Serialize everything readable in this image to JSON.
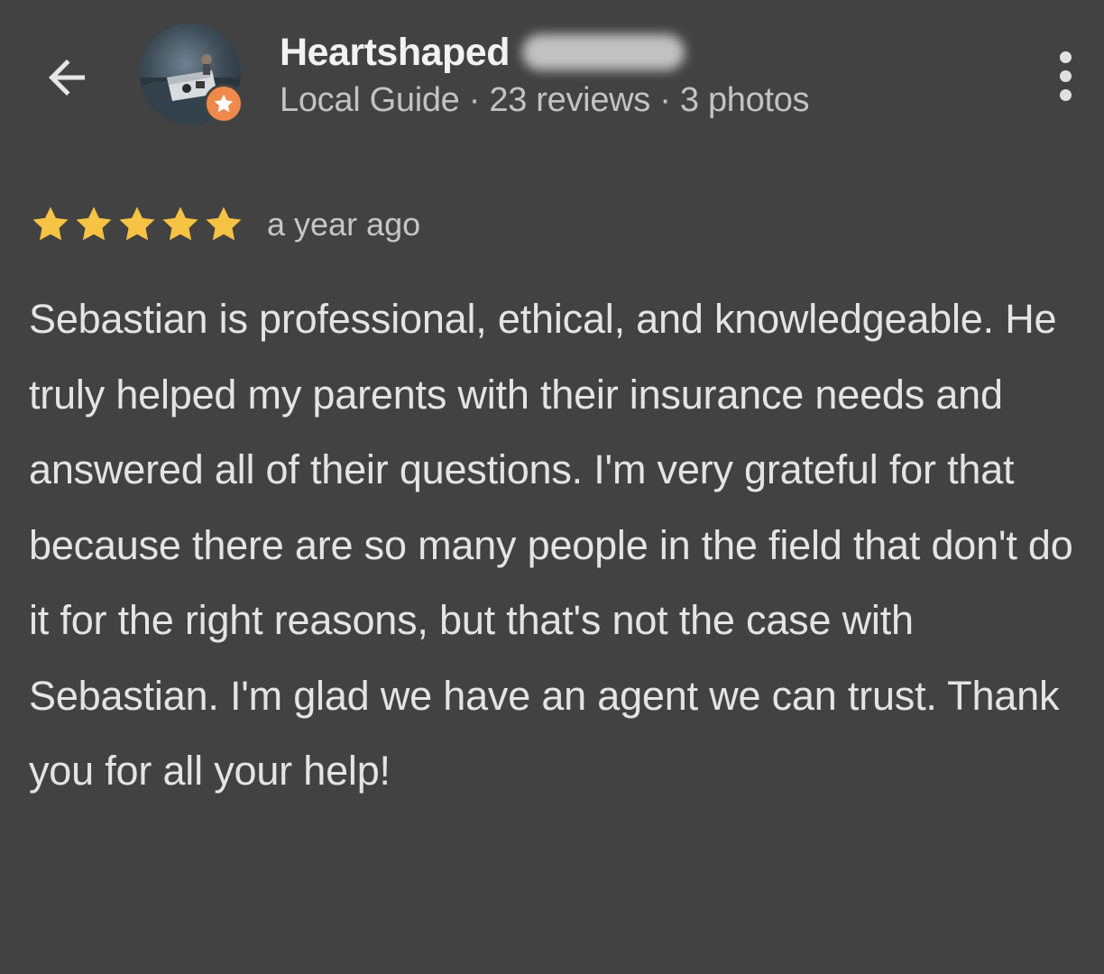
{
  "header": {
    "back_icon": "arrow-left-icon",
    "reviewer_name": "Heartshaped",
    "meta_text": "Local Guide · 23 reviews · 3 photos",
    "badge_icon": "star-icon",
    "menu_icon": "more-vert-icon"
  },
  "review": {
    "rating": 5,
    "rating_max": 5,
    "star_color": "#f6c344",
    "time_ago": "a year ago",
    "text": "Sebastian is professional, ethical, and knowledgeable. He truly helped my parents with their insurance needs and answered all of their questions. I'm very grateful for that because there are so many people in the field that don't do it for the right reasons, but that's not the case with Sebastian. I'm glad we have an agent we can trust. Thank you for all your help!"
  },
  "colors": {
    "background": "#424242",
    "badge": "#f08a4b",
    "text_primary": "#f2f2f2",
    "text_secondary": "#c3c3c3"
  }
}
